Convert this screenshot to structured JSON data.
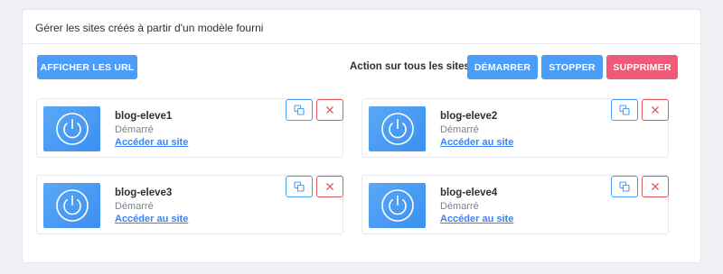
{
  "panel": {
    "title": "Gérer les sites créés à partir d'un modèle fourni"
  },
  "toolbar": {
    "show_urls_label": "AFFICHER LES URL",
    "bulk_label": "Action sur tous les sites :",
    "start_label": "DÉMARRER",
    "stop_label": "STOPPER",
    "delete_label": "SUPPRIMER"
  },
  "sites": [
    {
      "name": "blog-eleve1",
      "status": "Démarré",
      "link": "Accéder au site"
    },
    {
      "name": "blog-eleve2",
      "status": "Démarré",
      "link": "Accéder au site"
    },
    {
      "name": "blog-eleve3",
      "status": "Démarré",
      "link": "Accéder au site"
    },
    {
      "name": "blog-eleve4",
      "status": "Démarré",
      "link": "Accéder au site"
    }
  ],
  "icons": {
    "thumbnail": "power-icon",
    "copy": "copy-icon",
    "close": "close-icon"
  },
  "colors": {
    "primary": "#4a9df8",
    "danger": "#ef5a78",
    "link": "#3b82f6"
  }
}
